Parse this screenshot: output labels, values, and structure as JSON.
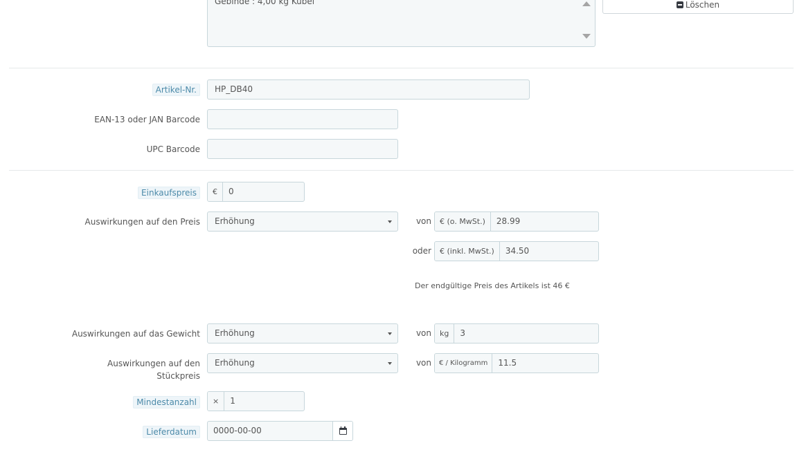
{
  "description_field": {
    "value": "Gebinde : 4,00 kg Kübel"
  },
  "delete_button": {
    "label": "Löschen"
  },
  "fields": {
    "reference": {
      "label": "Artikel-Nr.",
      "value": "HP_DB40"
    },
    "ean13": {
      "label": "EAN-13 oder JAN Barcode",
      "value": ""
    },
    "upc": {
      "label": "UPC Barcode",
      "value": ""
    },
    "wholesale_price": {
      "label": "Einkaufspreis",
      "currency": "€",
      "value": "0"
    },
    "price_impact": {
      "label": "Auswirkungen auf den Preis",
      "selected": "Erhöhung",
      "von_label": "von",
      "excl_addon": "€ (o. MwSt.)",
      "excl_value": "28.99",
      "oder_label": "oder",
      "incl_addon": "€ (inkl. MwSt.)",
      "incl_value": "34.50",
      "final_note": "Der endgültige Preis des Artikels ist 46 €"
    },
    "weight_impact": {
      "label": "Auswirkungen auf das Gewicht",
      "selected": "Erhöhung",
      "von_label": "von",
      "unit": "kg",
      "value": "3"
    },
    "unit_price_impact": {
      "label": "Auswirkungen auf den Stückpreis",
      "selected": "Erhöhung",
      "von_label": "von",
      "unit": "€ / Kilogramm",
      "value": "11.5"
    },
    "minimal_quantity": {
      "label": "Mindestanzahl",
      "prefix": "×",
      "value": "1"
    },
    "available_date": {
      "label": "Lieferdatum",
      "value": "0000-00-00"
    }
  }
}
